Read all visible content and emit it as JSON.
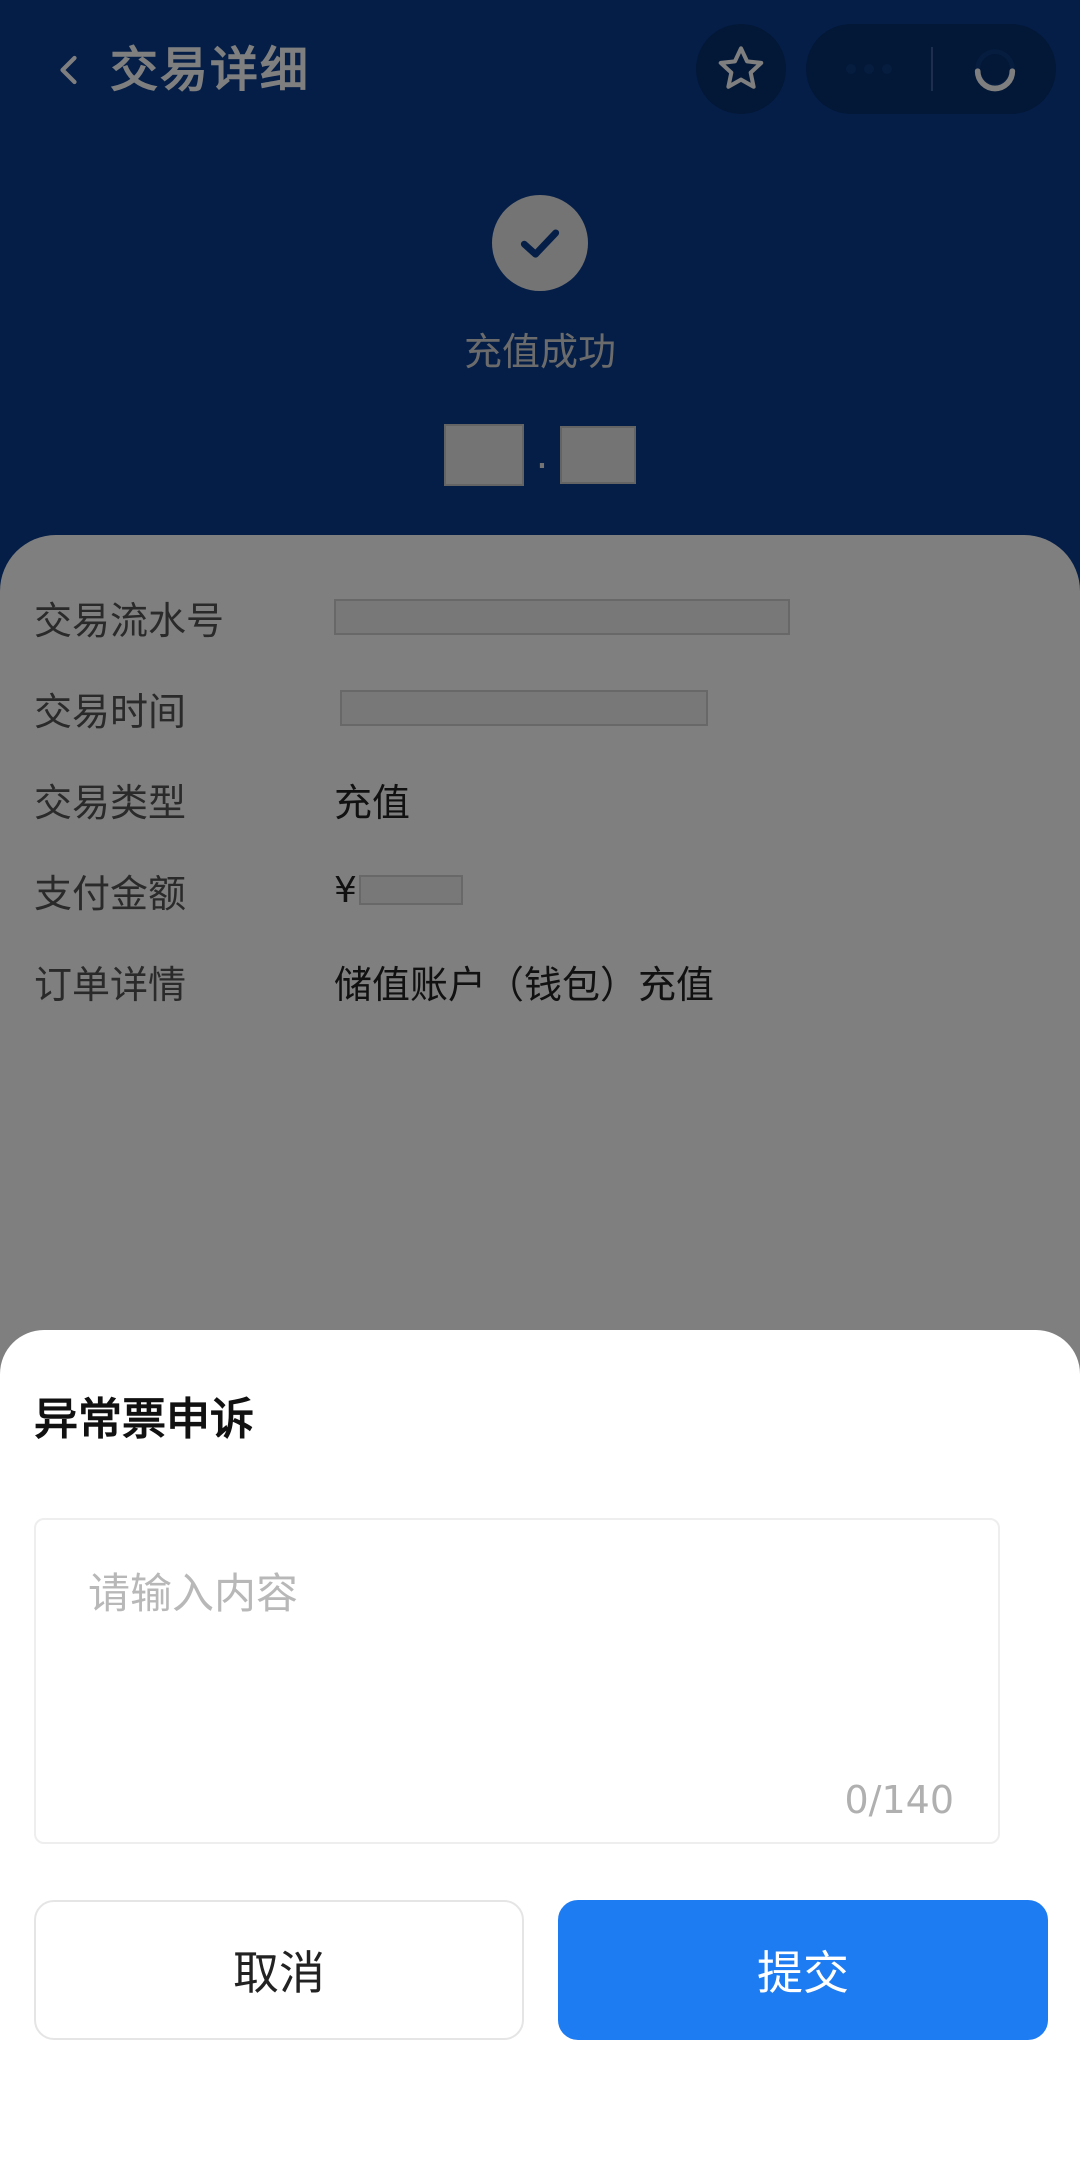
{
  "header": {
    "title": "交易详细",
    "icons": {
      "back": "chevron-left-icon",
      "favorite": "star-icon",
      "capsule_more": "more-icon",
      "capsule_close": "close-circle-icon"
    }
  },
  "status": {
    "text": "充值成功",
    "icon": "check-icon"
  },
  "details": {
    "rows": [
      {
        "label": "交易流水号",
        "value": ""
      },
      {
        "label": "交易时间",
        "value": ""
      },
      {
        "label": "交易类型",
        "value": "充值"
      },
      {
        "label": "支付金额",
        "value": "¥"
      },
      {
        "label": "订单详情",
        "value": "储值账户（钱包）充值"
      }
    ]
  },
  "sheet": {
    "title": "异常票申诉",
    "placeholder": "请输入内容",
    "counter": "0/140",
    "cancel_label": "取消",
    "submit_label": "提交"
  },
  "colors": {
    "header_bg": "#0a3d8f",
    "accent": "#1e7cf2",
    "overlay": "rgba(0,0,0,0.5)"
  }
}
